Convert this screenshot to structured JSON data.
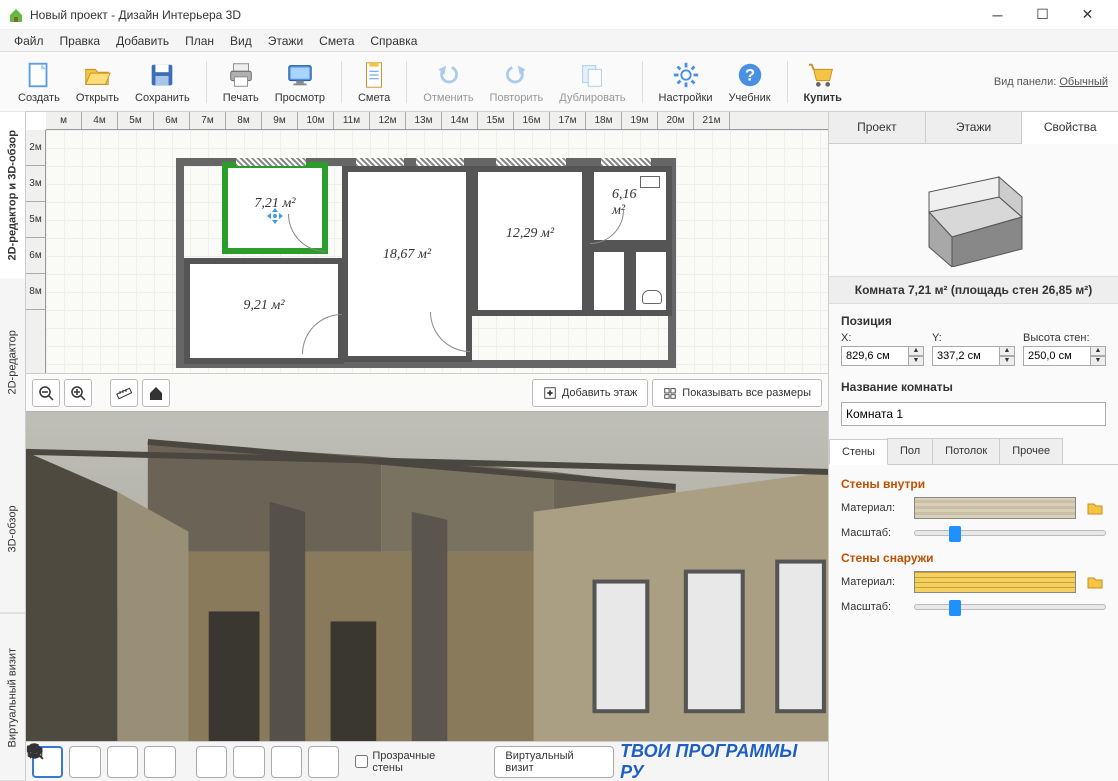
{
  "app": {
    "title": "Новый проект - Дизайн Интерьера 3D"
  },
  "menu": [
    "Файл",
    "Правка",
    "Добавить",
    "План",
    "Вид",
    "Этажи",
    "Смета",
    "Справка"
  ],
  "toolbar": {
    "create": "Создать",
    "open": "Открыть",
    "save": "Сохранить",
    "print": "Печать",
    "preview": "Просмотр",
    "estimate": "Смета",
    "undo": "Отменить",
    "redo": "Повторить",
    "duplicate": "Дублировать",
    "settings": "Настройки",
    "tutorial": "Учебник",
    "buy": "Купить",
    "panel_label": "Вид панели:",
    "panel_mode": "Обычный"
  },
  "vtabs": [
    "2D-редактор и 3D-обзор",
    "2D-редактор",
    "3D-обзор",
    "Виртуальный визит"
  ],
  "ruler_h": [
    "м",
    "4м",
    "5м",
    "6м",
    "7м",
    "8м",
    "9м",
    "10м",
    "11м",
    "12м",
    "13м",
    "14м",
    "15м",
    "16м",
    "17м",
    "18м",
    "19м",
    "20м",
    "21м"
  ],
  "ruler_v": [
    "2м",
    "3м",
    "5м",
    "6м",
    "8м"
  ],
  "rooms": {
    "r1": "7,21 м²",
    "r2": "18,67 м²",
    "r3": "12,29 м²",
    "r4": "6,16 м²",
    "r5": "9,21 м²"
  },
  "view2d_btns": {
    "add_floor": "Добавить этаж",
    "show_dims": "Показывать все размеры"
  },
  "view3d_btns": {
    "transparent": "Прозрачные стены",
    "virtual": "Виртуальный визит"
  },
  "watermark": "ТВОИ ПРОГРАММЫ РУ",
  "side": {
    "tabs": [
      "Проект",
      "Этажи",
      "Свойства"
    ],
    "room_title": "Комната 7,21 м²  (площадь стен 26,85 м²)",
    "position": "Позиция",
    "x": "X:",
    "y": "Y:",
    "h": "Высота стен:",
    "x_val": "829,6 см",
    "y_val": "337,2 см",
    "h_val": "250,0 см",
    "name_label": "Название комнаты",
    "name_val": "Комната 1",
    "wall_tabs": [
      "Стены",
      "Пол",
      "Потолок",
      "Прочее"
    ],
    "inside": "Стены внутри",
    "outside": "Стены снаружи",
    "material": "Материал:",
    "scale": "Масштаб:"
  }
}
